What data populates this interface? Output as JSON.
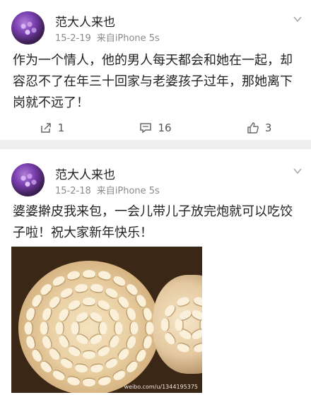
{
  "posts": [
    {
      "author": "范大人来也",
      "date": "15-2-19",
      "source": "来自iPhone 5s",
      "text": "作为一个情人，他的男人每天都会和她在一起，却容忍不了在年三十回家与老婆孩子过年，那她离下岗就不远了！",
      "reposts": "1",
      "comments": "16",
      "likes": "3"
    },
    {
      "author": "范大人来也",
      "date": "15-2-18",
      "source": "来自iPhone 5s",
      "text": "婆婆擀皮我来包，一会儿带儿子放完炮就可以吃饺子啦！祝大家新年快乐！",
      "photo_watermark": "weibo.com/u/1344195375"
    }
  ],
  "colors": {
    "background": "#eeeeee",
    "card": "#ffffff",
    "meta_text": "#8a8a8a"
  },
  "icons": [
    "avatar",
    "chevron-down-icon",
    "repost-icon",
    "comment-icon",
    "like-icon"
  ]
}
